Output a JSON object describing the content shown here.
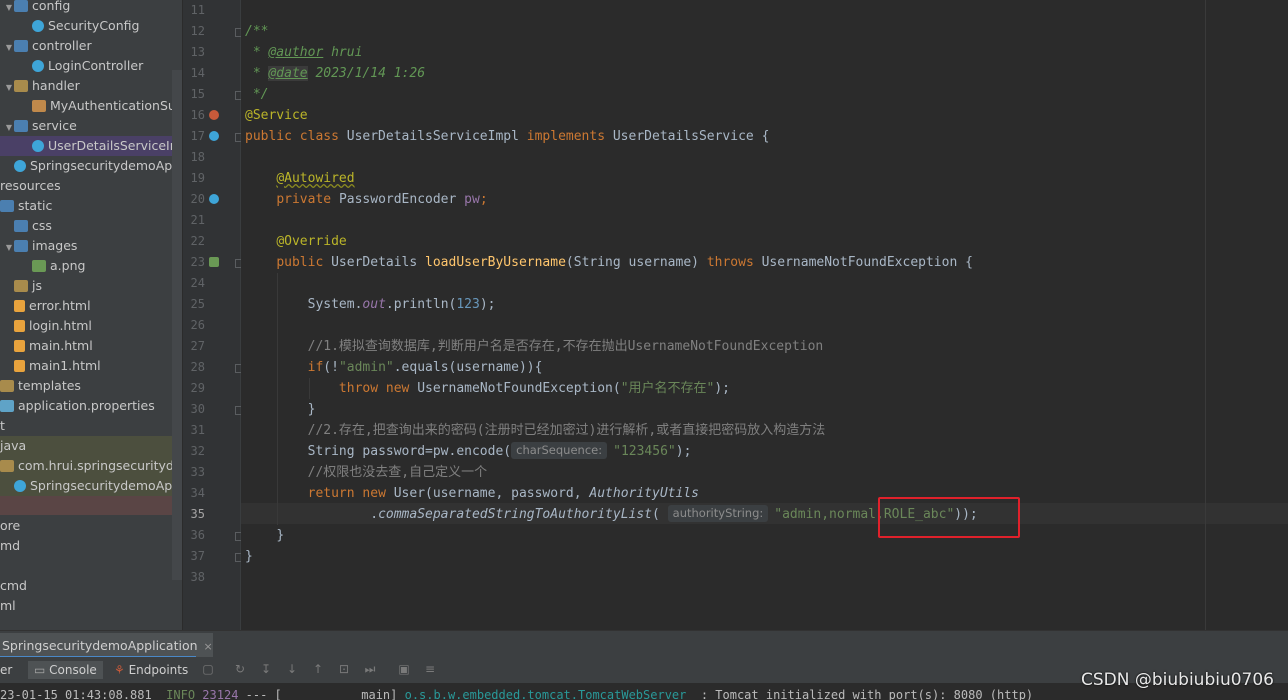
{
  "project_tree": [
    {
      "label": "config",
      "icon": "package-icon"
    },
    {
      "label": "SecurityConfig",
      "icon": "class-icon"
    },
    {
      "label": "controller",
      "icon": "package-icon"
    },
    {
      "label": "LoginController",
      "icon": "class-icon"
    },
    {
      "label": "handler",
      "icon": "package-icon"
    },
    {
      "label": "MyAuthenticationSuc",
      "icon": "class-icon"
    },
    {
      "label": "service",
      "icon": "package-icon"
    },
    {
      "label": "UserDetailsServiceIn",
      "icon": "class-icon"
    },
    {
      "label": "SpringsecuritydemoApp",
      "icon": "class-icon"
    },
    {
      "label": "resources",
      "icon": "folder-icon"
    },
    {
      "label": "static",
      "icon": "folder-icon"
    },
    {
      "label": "css",
      "icon": "folder-icon"
    },
    {
      "label": "images",
      "icon": "folder-icon"
    },
    {
      "label": "a.png",
      "icon": "image-file-icon"
    },
    {
      "label": "js",
      "icon": "folder-icon"
    },
    {
      "label": "error.html",
      "icon": "html-file-icon"
    },
    {
      "label": "login.html",
      "icon": "html-file-icon"
    },
    {
      "label": "main.html",
      "icon": "html-file-icon"
    },
    {
      "label": "main1.html",
      "icon": "html-file-icon"
    },
    {
      "label": "templates",
      "icon": "folder-icon"
    },
    {
      "label": "application.properties",
      "icon": "properties-file-icon"
    },
    {
      "label": "t",
      "icon": ""
    },
    {
      "label": "java",
      "icon": ""
    },
    {
      "label": "com.hrui.springsecuritydem",
      "icon": "package-icon"
    },
    {
      "label": "SpringsecuritydemoApp",
      "icon": "class-icon"
    },
    {
      "label": "",
      "icon": ""
    },
    {
      "label": "ore",
      "icon": ""
    },
    {
      "label": "md",
      "icon": ""
    },
    {
      "label": "",
      "icon": ""
    },
    {
      "label": "cmd",
      "icon": ""
    },
    {
      "label": "ml",
      "icon": ""
    }
  ],
  "line_numbers": [
    "11",
    "12",
    "13",
    "14",
    "15",
    "16",
    "17",
    "18",
    "19",
    "20",
    "21",
    "22",
    "23",
    "24",
    "25",
    "26",
    "27",
    "28",
    "29",
    "30",
    "31",
    "32",
    "33",
    "34",
    "35",
    "36",
    "37",
    "38"
  ],
  "code": {
    "l12": "/**",
    "l13_star": " * ",
    "l13_tag": "@author",
    "l13_val": " hrui",
    "l14_star": " * ",
    "l14_tag": "@date",
    "l14_val": " 2023/1/14 1:26",
    "l15": " */",
    "l16": "@Service",
    "l17_kw": "public class ",
    "l17_name": "UserDetailsServiceImpl ",
    "l17_kw2": "implements ",
    "l17_iface": "UserDetailsService {",
    "l19": "@Autowired",
    "l20_kw": "private ",
    "l20_rest": "PasswordEncoder ",
    "l20_field": "pw",
    "l20_semi": ";",
    "l22": "@Override",
    "l23_kw": "public ",
    "l23_type": "UserDetails ",
    "l23_fn": "loadUserByUsername",
    "l23_params": "(String username) ",
    "l23_kw2": "throws ",
    "l23_exc": "UsernameNotFoundException {",
    "l25_a": "System.",
    "l25_out": "out",
    "l25_b": ".println(",
    "l25_num": "123",
    "l25_c": ");",
    "l27": "//1.模拟查询数据库,判断用户名是否存在,不存在抛出UsernameNotFoundException",
    "l28_kw": "if",
    "l28_a": "(!",
    "l28_str": "\"admin\"",
    "l28_b": ".equals(username)){",
    "l29_kw": "throw new ",
    "l29_a": "UsernameNotFoundException(",
    "l29_str": "\"用户名不存在\"",
    "l29_b": ");",
    "l30": "}",
    "l31": "//2.存在,把查询出来的密码(注册时已经加密过)进行解析,或者直接把密码放入构造方法",
    "l32_a": "String password=pw.encode(",
    "l32_hint": "charSequence:",
    "l32_str": "\"123456\"",
    "l32_b": ");",
    "l33": "//权限也没去查,自己定义一个",
    "l34_kw": "return new ",
    "l34_a": "User(username, password, ",
    "l34_it": "AuthorityUtils",
    "l35_a": ".",
    "l35_m": "commaSeparatedStringToAuthorityList",
    "l35_b": "(",
    "l35_hint": "authorityString:",
    "l35_str": "\"admin,normal,ROLE_abc\"",
    "l35_c": "));",
    "l36": "}",
    "l37": "}"
  },
  "run_tab": {
    "label": "SpringsecuritydemoApplication",
    "close": "×"
  },
  "toolbar": {
    "first": "er",
    "console": "Console",
    "endpoints": "Endpoints"
  },
  "console": {
    "ts": "23-01-15 01:43:08.881  ",
    "level": "INFO",
    "pid": " 23124",
    "rest": " --- [           main] ",
    "logger": "o.s.b.w.embedded.tomcat.TomcatWebServer",
    "msg": "  : Tomcat initialized with port(s): 8080 (http)"
  },
  "watermark": "CSDN @biubiubiu0706"
}
